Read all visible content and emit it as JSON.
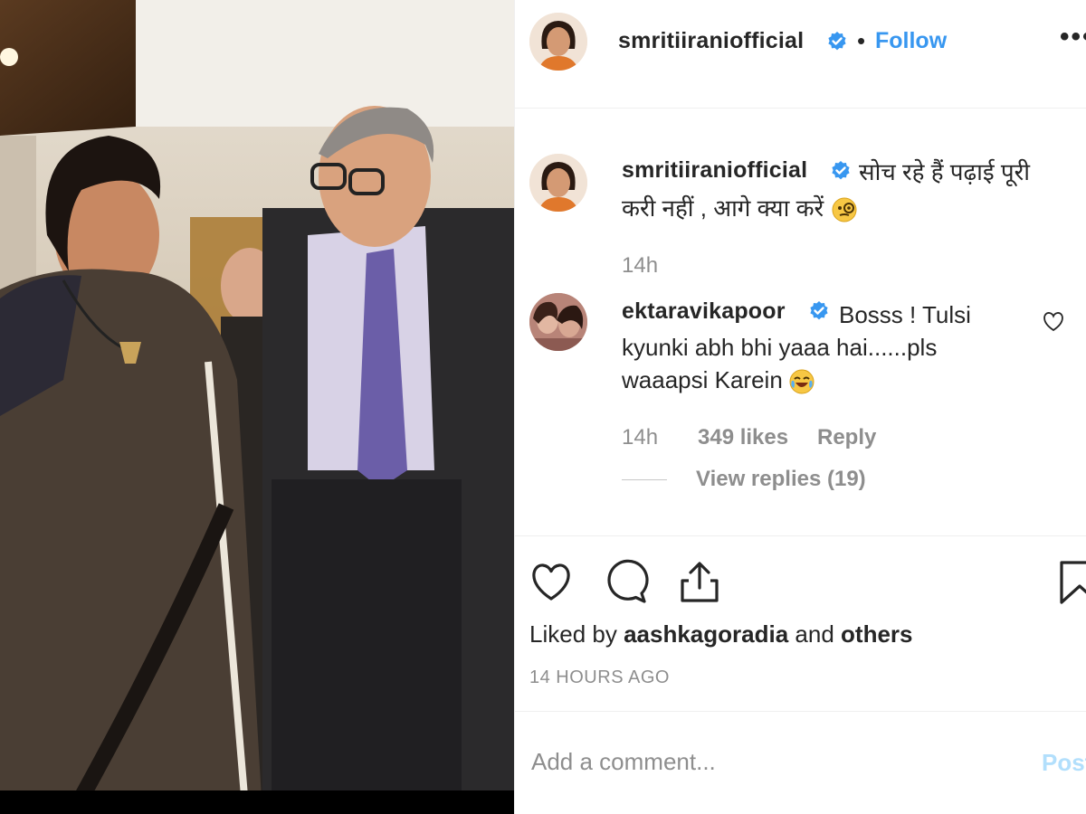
{
  "post": {
    "username": "smritiiraniofficial",
    "follow_label": "Follow",
    "separator": "•",
    "more_icon": "more-horizontal-icon"
  },
  "caption": {
    "username": "smritiiraniofficial",
    "text_line1": "सोच रहे हैं पढ़ाई पूरी",
    "text_line2": "करी नहीं , आगे क्या करें",
    "emoji": "monocle-face-emoji",
    "time": "14h"
  },
  "comment": {
    "username": "ektaravikapoor",
    "line1": "Bosss ! Tulsi",
    "line2": "kyunki abh bhi yaaa hai......pls",
    "line3": "waaapsi Karein",
    "emoji": "laughing-tears-emoji",
    "time": "14h",
    "likes": "349 likes",
    "reply_label": "Reply",
    "view_replies": "View replies (19)"
  },
  "actions": {
    "like_icon": "heart-icon",
    "comment_icon": "comment-bubble-icon",
    "share_icon": "share-icon",
    "save_icon": "bookmark-icon"
  },
  "likes": {
    "prefix": "Liked by",
    "user": "aashkagoradia",
    "connector": "and",
    "others": "others"
  },
  "timestamp": "14 HOURS AGO",
  "add_comment": {
    "placeholder": "Add a comment...",
    "post_label": "Post"
  },
  "colors": {
    "link": "#3897f0",
    "verified": "#3897f0",
    "muted": "#8e8e8e",
    "text": "#262626",
    "post_disabled": "#b2dffc"
  }
}
